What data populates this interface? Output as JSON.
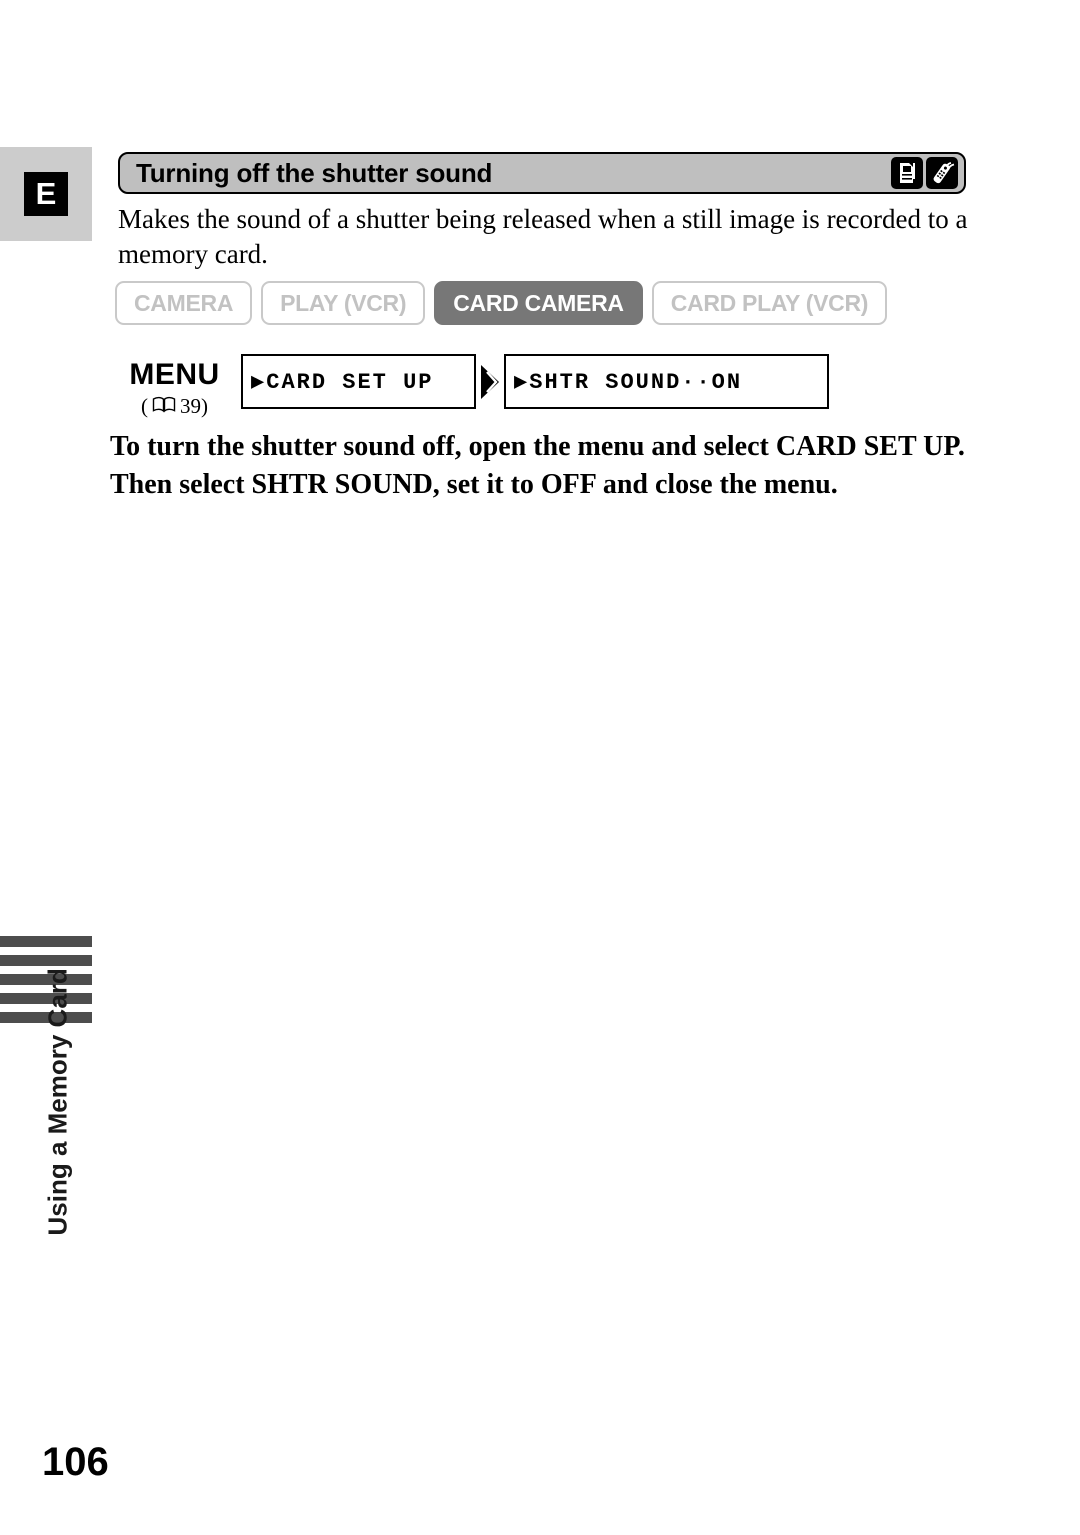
{
  "section_tab": {
    "letter": "E"
  },
  "heading": {
    "title": "Turning off the shutter sound",
    "icons": [
      {
        "name": "memory-card-icon",
        "label": "memory card"
      },
      {
        "name": "remote-control-icon",
        "label": "wireless controller"
      }
    ]
  },
  "intro": {
    "text": "Makes the sound of a shutter being released when a still image is recorded to a memory card."
  },
  "modes": [
    {
      "label": "CAMERA",
      "active": false
    },
    {
      "label": "PLAY (VCR)",
      "active": false
    },
    {
      "label": "CARD CAMERA",
      "active": true
    },
    {
      "label": "CARD PLAY (VCR)",
      "active": false
    }
  ],
  "menu": {
    "label": "MENU",
    "ref_open": "(",
    "ref_page": "39)",
    "steps": [
      {
        "text": "▶CARD SET UP"
      },
      {
        "text": "▶SHTR SOUND··ON"
      }
    ]
  },
  "instruction": {
    "text": "To turn the shutter sound off, open the menu and select CARD SET UP. Then select SHTR SOUND, set it to OFF and close the menu."
  },
  "running_title": {
    "text": "Using a Memory Card",
    "bar_count": 5
  },
  "page": {
    "number": "106"
  },
  "colors": {
    "heading_bar_bg": "#bfbfbf",
    "section_tab_bg": "#cccccc",
    "active_mode_bg": "#777777",
    "inactive_mode_fg": "#c2c2c2",
    "index_bar": "#4d4d4d"
  }
}
